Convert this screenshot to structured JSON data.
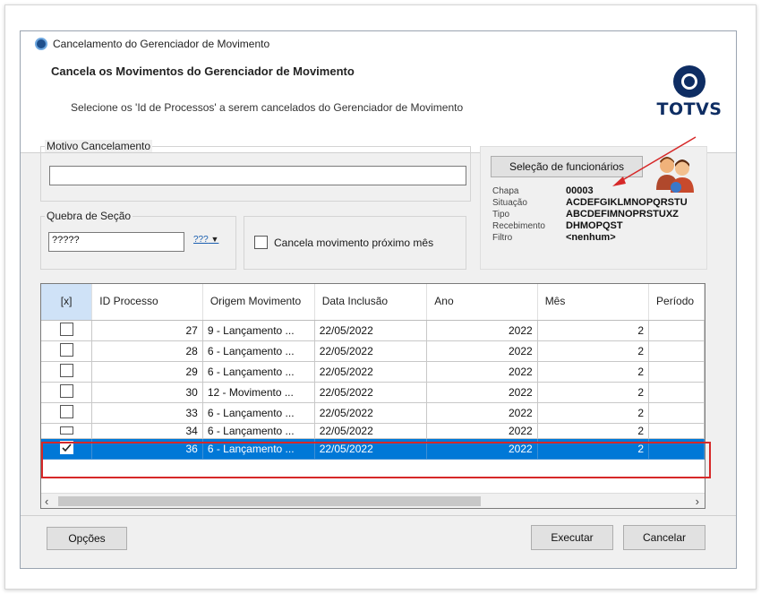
{
  "window": {
    "title": "Cancelamento do Gerenciador de Movimento"
  },
  "header": {
    "title": "Cancela os Movimentos do Gerenciador de Movimento",
    "subtitle": "Selecione os 'Id de Processos' a serem cancelados do Gerenciador de Movimento",
    "logo_text": "TOTVS"
  },
  "motivo": {
    "legend": "Motivo Cancelamento",
    "value": ""
  },
  "quebra": {
    "legend": "Quebra de Seção",
    "value": "?????",
    "lookup_label": "???"
  },
  "cancela_proximo": {
    "label": "Cancela movimento próximo mês",
    "checked": false
  },
  "employees": {
    "button_label": "Seleção de funcionários",
    "fields": [
      {
        "label": "Chapa",
        "value": "00003"
      },
      {
        "label": "Situação",
        "value": "ACDEFGIKLMNOPQRSTU"
      },
      {
        "label": "Tipo",
        "value": "ABCDEFIMNOPRSTUXZ"
      },
      {
        "label": "Recebimento",
        "value": "DHMOPQST"
      },
      {
        "label": "Filtro",
        "value": "<nenhum>"
      }
    ]
  },
  "grid": {
    "columns": [
      "[x]",
      "ID Processo",
      "Origem Movimento",
      "Data Inclusão",
      "Ano",
      "Mês",
      "Período"
    ],
    "rows": [
      {
        "checked": false,
        "id": "27",
        "origem": "9 - Lançamento ...",
        "data": "22/05/2022",
        "ano": "2022",
        "mes": "2"
      },
      {
        "checked": false,
        "id": "28",
        "origem": "6 - Lançamento ...",
        "data": "22/05/2022",
        "ano": "2022",
        "mes": "2"
      },
      {
        "checked": false,
        "id": "29",
        "origem": "6 - Lançamento ...",
        "data": "22/05/2022",
        "ano": "2022",
        "mes": "2"
      },
      {
        "checked": false,
        "id": "30",
        "origem": "12 - Movimento ...",
        "data": "22/05/2022",
        "ano": "2022",
        "mes": "2"
      },
      {
        "checked": false,
        "id": "33",
        "origem": "6 - Lançamento ...",
        "data": "22/05/2022",
        "ano": "2022",
        "mes": "2"
      },
      {
        "checked": false,
        "id": "34",
        "origem": "6 - Lançamento ...",
        "data": "22/05/2022",
        "ano": "2022",
        "mes": "2"
      },
      {
        "checked": true,
        "id": "36",
        "origem": "6 - Lançamento ...",
        "data": "22/05/2022",
        "ano": "2022",
        "mes": "2"
      }
    ],
    "selected_index": 6
  },
  "footer": {
    "options_label": "Opções",
    "execute_label": "Executar",
    "cancel_label": "Cancelar"
  },
  "colors": {
    "selection": "#0078d7",
    "annotation": "#d62828",
    "logo": "#0e2d63"
  }
}
